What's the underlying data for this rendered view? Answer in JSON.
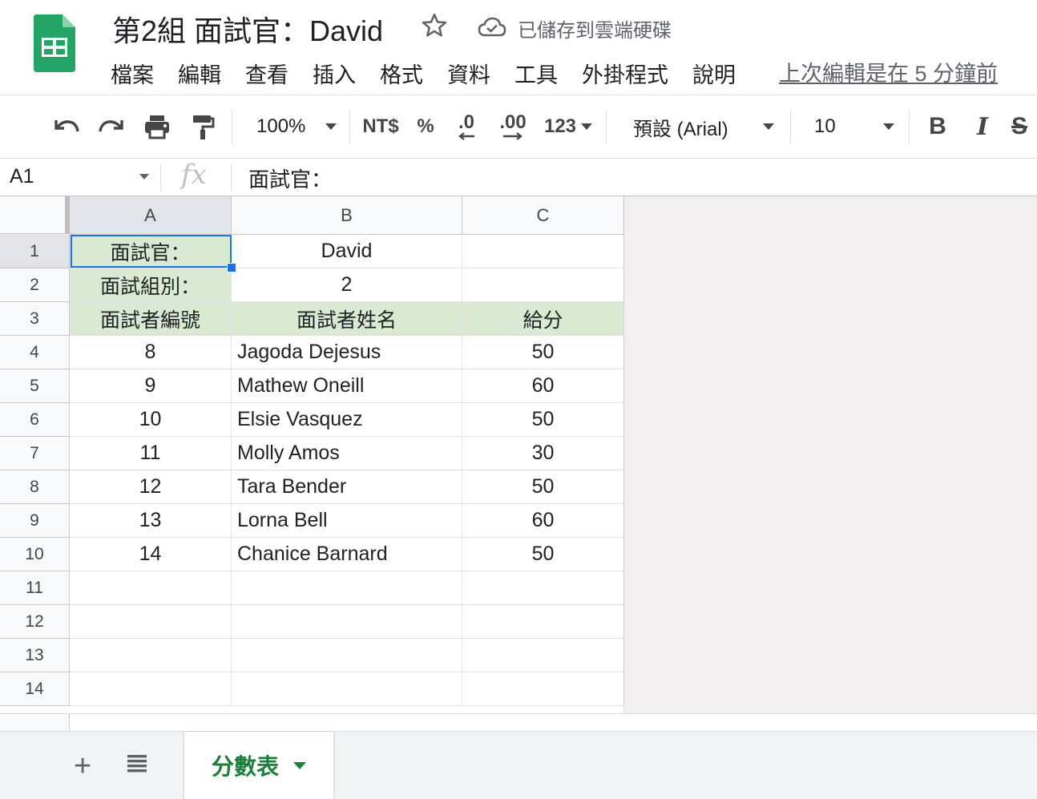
{
  "header": {
    "doc_title": "第2組 面試官：David",
    "save_status": "已儲存到雲端硬碟",
    "last_edit": "上次編輯是在 5 分鐘前",
    "menu": [
      "檔案",
      "編輯",
      "查看",
      "插入",
      "格式",
      "資料",
      "工具",
      "外掛程式",
      "說明"
    ]
  },
  "toolbar": {
    "zoom": "100%",
    "currency": "NT$",
    "percent": "%",
    "decrease_decimal": ".0",
    "increase_decimal": ".00",
    "number_format": "123",
    "font": "預設 (Arial)",
    "font_size": "10",
    "bold": "B",
    "italic": "I",
    "strikethrough": "S"
  },
  "formula_bar": {
    "name_box": "A1",
    "fx": "fx",
    "content": "面試官："
  },
  "grid": {
    "columns": [
      "A",
      "B",
      "C"
    ],
    "row_numbers": [
      "1",
      "2",
      "3",
      "4",
      "5",
      "6",
      "7",
      "8",
      "9",
      "10",
      "11",
      "12",
      "13",
      "14"
    ],
    "rows": [
      [
        "面試官：",
        "David",
        ""
      ],
      [
        "面試組別：",
        "2",
        ""
      ],
      [
        "面試者編號",
        "面試者姓名",
        "給分"
      ],
      [
        "8",
        "Jagoda Dejesus",
        "50"
      ],
      [
        "9",
        "Mathew Oneill",
        "60"
      ],
      [
        "10",
        "Elsie Vasquez",
        "50"
      ],
      [
        "11",
        "Molly Amos",
        "30"
      ],
      [
        "12",
        "Tara Bender",
        "50"
      ],
      [
        "13",
        "Lorna Bell",
        "60"
      ],
      [
        "14",
        "Chanice Barnard",
        "50"
      ],
      [
        "",
        "",
        ""
      ],
      [
        "",
        "",
        ""
      ],
      [
        "",
        "",
        ""
      ],
      [
        "",
        "",
        ""
      ]
    ],
    "header_fill": "#d9ead3",
    "selection_color": "#1a73e8"
  },
  "sheets": {
    "add_label": "+",
    "active_tab": "分數表",
    "tab_color": "#188038"
  },
  "colors": {
    "logo_green": "#0f9d58"
  }
}
